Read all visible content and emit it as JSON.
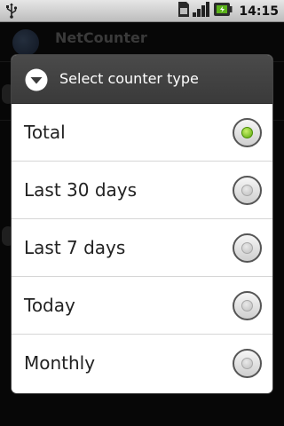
{
  "statusbar": {
    "time": "14:15",
    "icons": [
      "usb-icon",
      "sim-icon",
      "signal-icon",
      "battery-icon"
    ]
  },
  "background_app": {
    "title": "NetCounter"
  },
  "dialog": {
    "title": "Select counter type",
    "icon": "arrow-down-circle-icon",
    "options": [
      {
        "label": "Total",
        "selected": true
      },
      {
        "label": "Last 30 days",
        "selected": false
      },
      {
        "label": "Last 7 days",
        "selected": false
      },
      {
        "label": "Today",
        "selected": false
      },
      {
        "label": "Monthly",
        "selected": false
      }
    ]
  },
  "colors": {
    "selected_radio": "#5aa80c",
    "dialog_header": "#404040"
  }
}
